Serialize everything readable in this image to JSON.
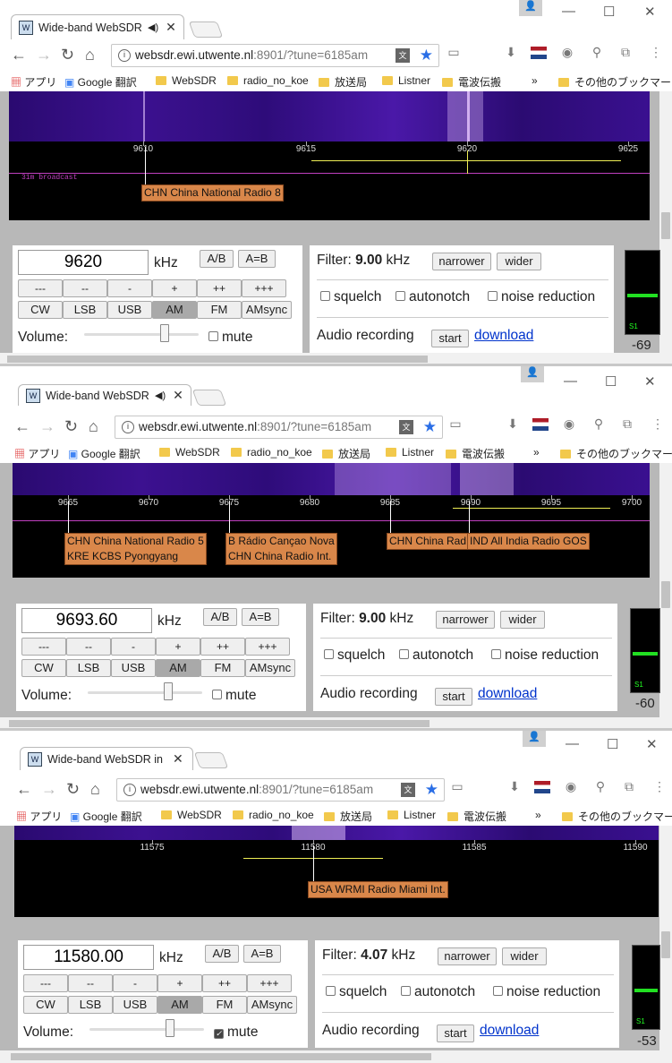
{
  "browser": {
    "tab_title": "Wide-band WebSDR in Enschede",
    "tab_title_short_1": "Wide-band WebSDR",
    "tab_title_short_2": "Wide-band WebSDR i",
    "tab_title_short_3": "Wide-band WebSDR in E",
    "url_host": "websdr.ewi.utwente.nl",
    "url_rest": ":8901/?tune=6185am",
    "bookmarks": [
      "アプリ",
      "Google 翻訳",
      "WebSDR",
      "radio_no_koe",
      "放送局",
      "Listner",
      "電波伝搬",
      "»",
      "その他のブックマーク"
    ],
    "icons": {
      "back": "back-arrow-icon",
      "forward": "forward-arrow-icon",
      "reload": "reload-icon",
      "home": "home-icon",
      "star": "star-icon"
    }
  },
  "windows": [
    {
      "freq": "9620",
      "unit": "kHz",
      "ticks": [
        "9610",
        "9615",
        "9620",
        "9625"
      ],
      "band_label": "31m broadcast",
      "stations": [
        {
          "text": "CHN China National Radio 8"
        }
      ],
      "filter": "9.00",
      "volume": 0.6,
      "mute": false,
      "db": "-69"
    },
    {
      "freq": "9693.60",
      "unit": "kHz",
      "ticks": [
        "9665",
        "9670",
        "9675",
        "9680",
        "9685",
        "9690",
        "9695",
        "9700"
      ],
      "stations": [
        {
          "text": "CHN China National Radio 5",
          "text2": "KRE KCBS Pyongyang"
        },
        {
          "text": "B Rádio Cançao Nova",
          "text2": "CHN China Radio Int."
        },
        {
          "text": "CHN China Rad"
        },
        {
          "text": "IND All India Radio GOS"
        }
      ],
      "filter": "9.00",
      "volume": 0.62,
      "mute": false,
      "db": "-60"
    },
    {
      "freq": "11580.00",
      "unit": "kHz",
      "ticks": [
        "11575",
        "11580",
        "11585",
        "11590"
      ],
      "stations": [
        {
          "text": "USA WRMI Radio Miami Int."
        }
      ],
      "filter": "4.07",
      "volume": 0.62,
      "mute": true,
      "db": "-53"
    }
  ],
  "controls": {
    "ab": "A/B",
    "aeqb": "A=B",
    "steps": [
      "---",
      "--",
      "-",
      "+",
      "++",
      "+++"
    ],
    "modes": [
      "CW",
      "LSB",
      "USB",
      "AM",
      "FM",
      "AMsync"
    ],
    "active_mode": "AM",
    "volume_label": "Volume:",
    "mute_label": "mute",
    "filter_label": "Filter:",
    "narrower": "narrower",
    "wider": "wider",
    "squelch": "squelch",
    "autonotch": "autonotch",
    "noise_reduction": "noise reduction",
    "audio_recording": "Audio recording",
    "start": "start",
    "download": "download",
    "s1": "S1",
    "check_mark": "✓"
  }
}
